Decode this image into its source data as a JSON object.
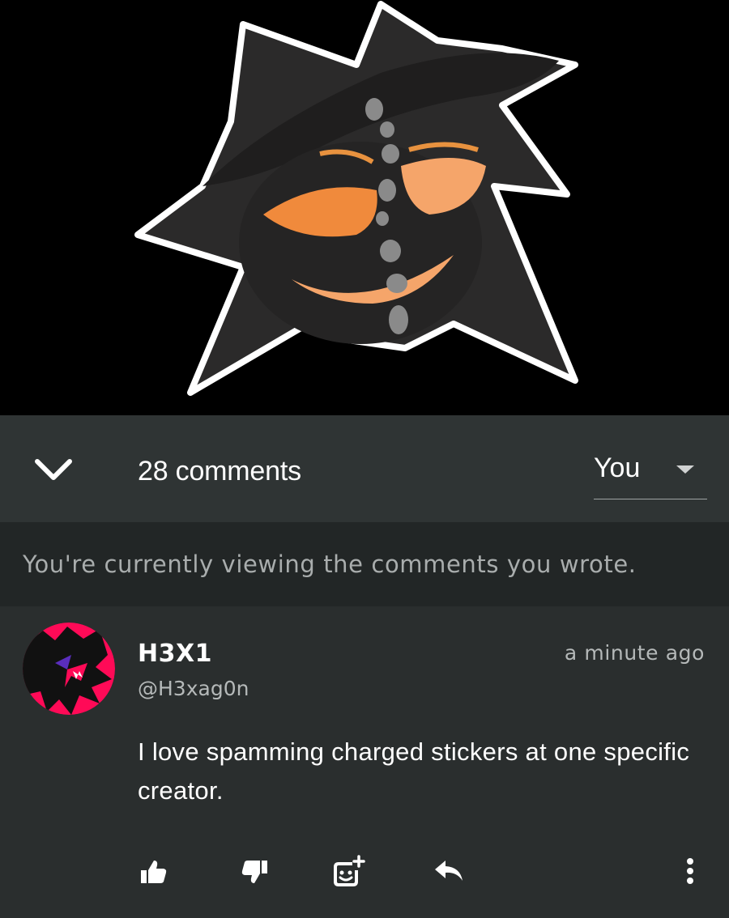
{
  "artwork": {
    "icon": "character-artwork"
  },
  "comments_header": {
    "collapse_icon": "chevron-down-icon",
    "count_label": "28 comments",
    "filter": {
      "selected": "You",
      "icon": "dropdown-arrow-icon"
    }
  },
  "notice": {
    "text": "You're currently viewing the comments you wrote."
  },
  "comment": {
    "author_name": "H3X1",
    "author_handle": "@H3xag0n",
    "timestamp": "a minute ago",
    "body": "I love spamming charged stickers at one specific creator.",
    "avatar_colors": {
      "background": "#ff0a57",
      "figure": "#111111",
      "accent": "#5a2dbd"
    },
    "actions": [
      {
        "name": "like-button",
        "icon": "thumbs-up-icon"
      },
      {
        "name": "dislike-button",
        "icon": "thumbs-down-icon"
      },
      {
        "name": "sticker-button",
        "icon": "add-sticker-icon"
      },
      {
        "name": "reply-button",
        "icon": "reply-icon"
      },
      {
        "name": "more-options-button",
        "icon": "more-vertical-icon"
      }
    ]
  },
  "colors": {
    "header_bg": "#2f3434",
    "notice_bg": "#222626",
    "comment_bg": "#2a2e2e",
    "muted_text": "#a9adad"
  }
}
